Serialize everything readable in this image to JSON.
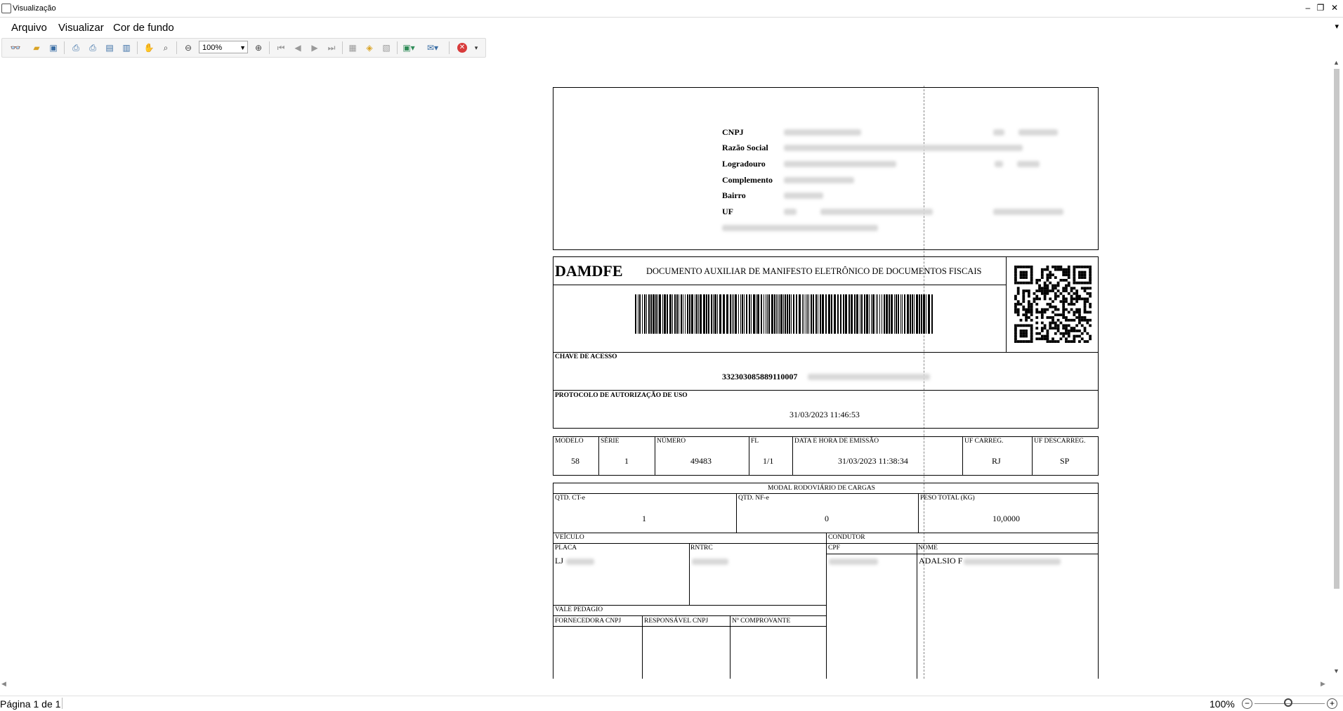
{
  "window": {
    "title": "Visualização"
  },
  "menu": {
    "items": [
      "Arquivo",
      "Visualizar",
      "Cor de fundo"
    ]
  },
  "toolbar": {
    "zoom_value": "100%"
  },
  "status": {
    "page_info": "Página 1 de 1",
    "zoom": "100%"
  },
  "icons": [
    "binoculars-icon",
    "open-folder-icon",
    "save-icon",
    "print-setup-icon",
    "print-icon",
    "print-preview-icon",
    "export-icon",
    "hand-tool-icon",
    "zoom-magnifier-icon",
    "zoom-out-icon",
    "zoom-in-icon",
    "first-page-icon",
    "prev-page-icon",
    "next-page-icon",
    "last-page-icon",
    "page-setup-icon",
    "watermark-icon",
    "edit-page-icon",
    "export-dropdown-icon",
    "email-icon",
    "close-preview-icon"
  ],
  "doc": {
    "emitter": {
      "cnpj_label": "CNPJ",
      "razao_label": "Razão Social",
      "logradouro_label": "Logradouro",
      "complemento_label": "Complemento",
      "bairro_label": "Bairro",
      "uf_label": "UF"
    },
    "header": {
      "damdfe": "DAMDFE",
      "subtitle": "DOCUMENTO AUXILIAR DE MANIFESTO ELETRÔNICO DE DOCUMENTOS FISCAIS"
    },
    "chave": {
      "label": "CHAVE DE ACESSO",
      "value": "332303085889110007"
    },
    "protocolo": {
      "label": "PROTOCOLO DE AUTORIZAÇÃO DE USO",
      "value": "31/03/2023 11:46:53"
    },
    "info": {
      "modelo_label": "MODELO",
      "modelo": "58",
      "serie_label": "SÉRIE",
      "serie": "1",
      "numero_label": "NÚMERO",
      "numero": "49483",
      "fl_label": "FL",
      "fl": "1/1",
      "emissao_label": "DATA E HORA DE EMISSÃO",
      "emissao": "31/03/2023 11:38:34",
      "uf_carreg_label": "UF CARREG.",
      "uf_carreg": "RJ",
      "uf_descarreg_label": "UF DESCARREG.",
      "uf_descarreg": "SP"
    },
    "modal": {
      "title": "MODAL RODOVIÁRIO DE CARGAS",
      "qtd_cte_label": "QTD. CT-e",
      "qtd_cte": "1",
      "qtd_nfe_label": "QTD. NF-e",
      "qtd_nfe": "0",
      "peso_label": "PESO TOTAL (KG)",
      "peso": "10,0000",
      "veiculo_label": "VEÍCULO",
      "condutor_label": "CONDUTOR",
      "placa_label": "PLACA",
      "placa": "LJ",
      "rntrc_label": "RNTRC",
      "cpf_label": "CPF",
      "nome_label": "NOME",
      "nome": "ADALSIO F",
      "vale_label": "VALE PEDAGIO",
      "fornecedora_label": "FORNECEDORA CNPJ",
      "responsavel_label": "RESPONSÁVEL CNPJ",
      "comprovante_label": "Nº COMPROVANTE"
    }
  }
}
